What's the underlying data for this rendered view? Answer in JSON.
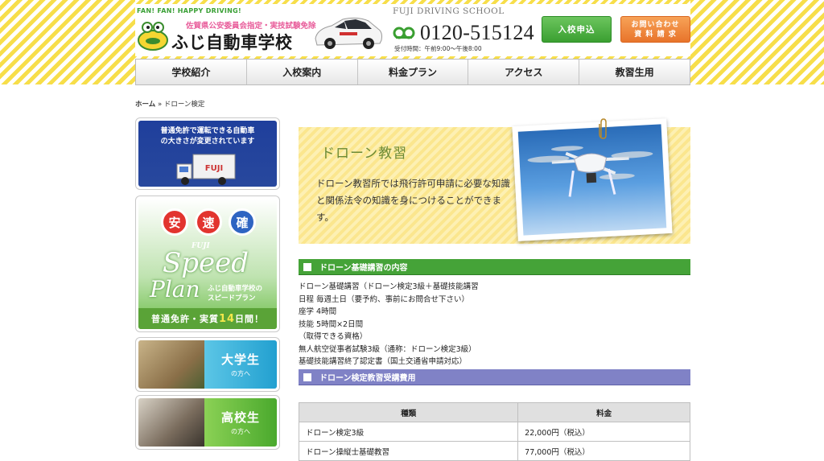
{
  "header": {
    "tagline": "FAN! FAN! HAPPY DRIVING!",
    "prefecture_note": "佐賀県公安委員会指定・実技試験免除",
    "brand": "ふじ自動車学校",
    "school_en": "FUJI DRIVING SCHOOL",
    "phone": "0120-515124",
    "hours": "受付時間：午前9:00～午後8:00",
    "enroll_button": "入校申込",
    "contact_line1": "お問い合わせ",
    "contact_line2": "資 料 請 求"
  },
  "nav": [
    "学校紹介",
    "入校案内",
    "料金プラン",
    "アクセス",
    "教習生用"
  ],
  "breadcrumb": {
    "home": "ホーム",
    "sep": " » ",
    "current": "ドローン検定"
  },
  "sidebar": {
    "banner1_line1": "普通免許で運転できる自動車",
    "banner1_line2": "の大きさが変更されています",
    "banner1_truck_label": "FUJI",
    "speed": {
      "circles": [
        "安",
        "速",
        "確"
      ],
      "fuji": "FUJI",
      "speed": "Speed",
      "plan": "Plan",
      "jp_line1": "ふじ自動車学校の",
      "jp_line2": "スピードプラン",
      "bottom_pre": "普通免許・実質",
      "bottom_num": "14",
      "bottom_post": "日間！"
    },
    "university": {
      "big": "大学生",
      "small": "の方へ"
    },
    "highschool": {
      "big": "高校生",
      "small": "の方へ"
    }
  },
  "hero": {
    "title": "ドローン教習",
    "text": "ドローン教習所では飛行許可申請に必要な知識と関係法令の知識を身につけることができます。"
  },
  "section1": {
    "title": "ドローン基礎講習の内容",
    "lines": [
      "ドローン基礎講習（ドローン検定3級＋基礎技能講習",
      "日程 毎週土日（要予約、事前にお問合せ下さい）",
      "座学 4時間",
      "技能 5時間×2日間",
      "（取得できる資格）",
      "無人航空従事者試験3級（通称：ドローン検定3級）",
      "基礎技能講習終了認定書（国土交通省申請対応）"
    ]
  },
  "section2": {
    "title": "ドローン検定教習受講費用",
    "table": {
      "headers": [
        "種類",
        "料金"
      ],
      "rows": [
        [
          "ドローン検定3級",
          "22,000円（税込）"
        ],
        [
          "ドローン操縦士基礎教習",
          "77,000円（税込）"
        ]
      ]
    }
  },
  "colors": {
    "green": "#45a338",
    "purple": "#8082c6",
    "orange": "#e8742b",
    "yellow": "#f7de4a"
  }
}
